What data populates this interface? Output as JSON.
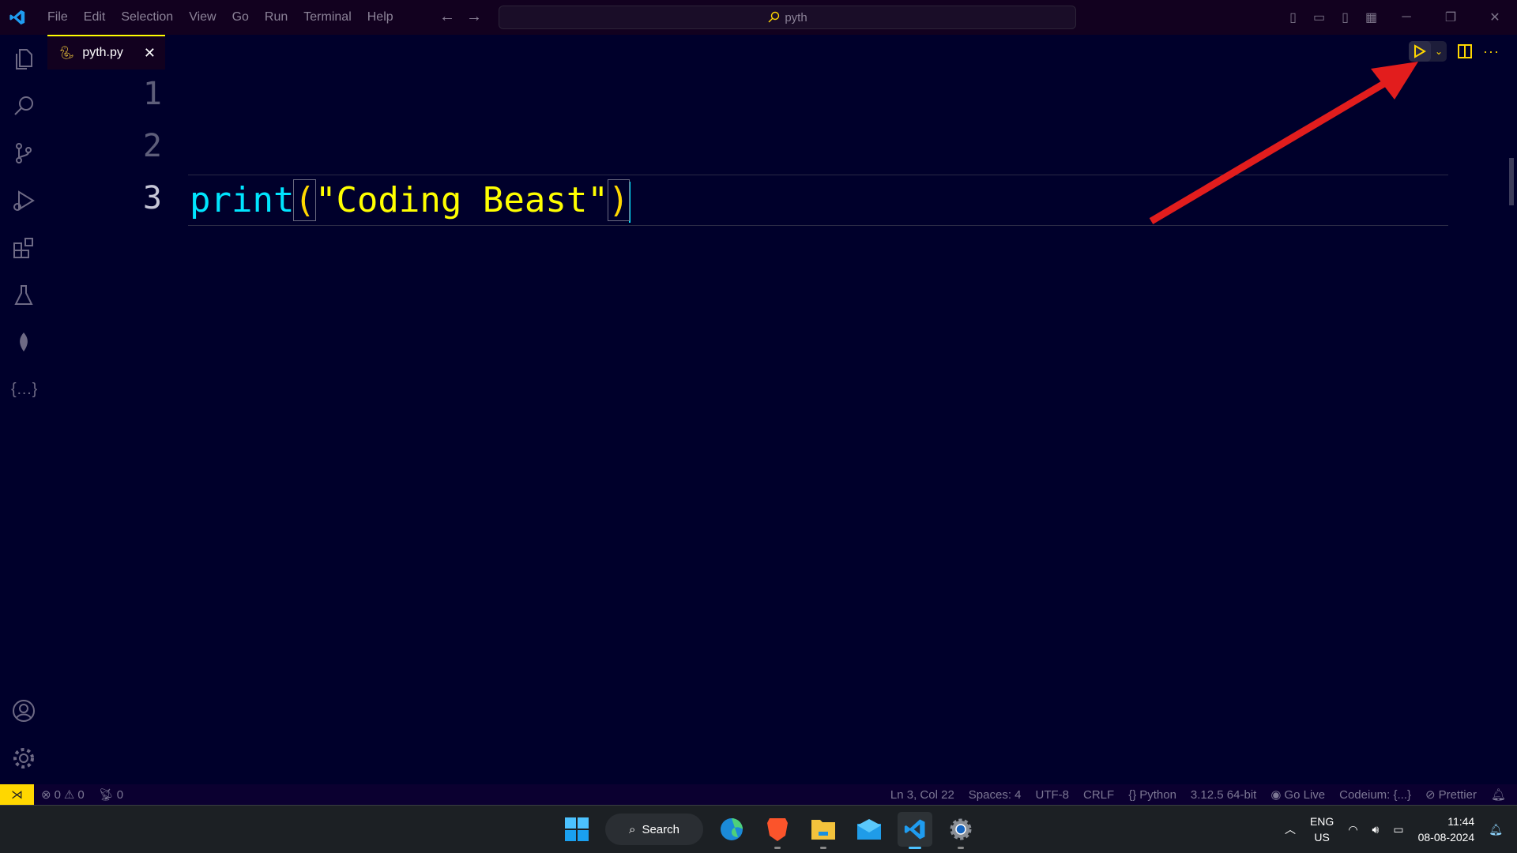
{
  "titlebar": {
    "menu": [
      "File",
      "Edit",
      "Selection",
      "View",
      "Go",
      "Run",
      "Terminal",
      "Help"
    ],
    "search_text": "pyth"
  },
  "tab": {
    "filename": "pyth.py",
    "close": "✕"
  },
  "editor": {
    "line_numbers": [
      "1",
      "2",
      "3"
    ],
    "code": {
      "fn": "print",
      "open": "(",
      "string": "\"Coding Beast\"",
      "close": ")"
    }
  },
  "status": {
    "errors": "0",
    "warnings": "0",
    "ports": "0",
    "position": "Ln 3, Col 22",
    "spaces": "Spaces: 4",
    "encoding": "UTF-8",
    "eol": "CRLF",
    "language": "Python",
    "interpreter": "3.12.5 64-bit",
    "golive": "Go Live",
    "codeium": "Codeium: {...}",
    "prettier": "Prettier"
  },
  "taskbar": {
    "search_label": "Search",
    "lang_line1": "ENG",
    "lang_line2": "US",
    "time": "11:44",
    "date": "08-08-2024"
  },
  "colors": {
    "accent": "#ffff00",
    "annotation_arrow": "#e21d1d",
    "editor_bg": "#00002b"
  }
}
